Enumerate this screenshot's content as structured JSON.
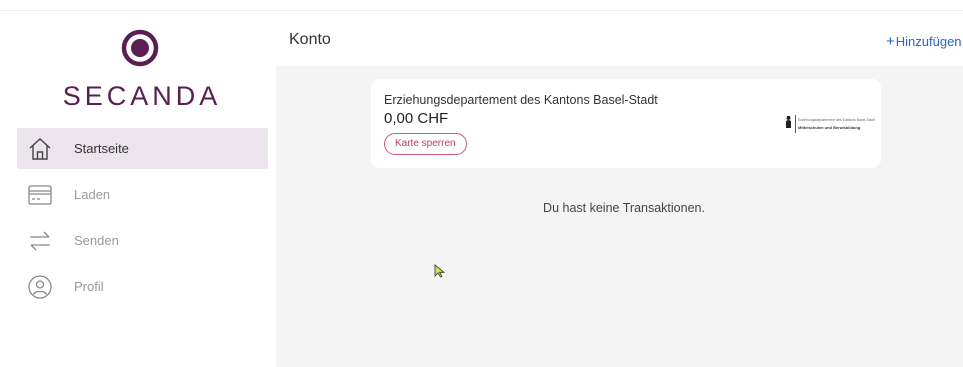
{
  "brand": {
    "name": "SECANDA",
    "color": "#5a1e55"
  },
  "sidebar": {
    "items": [
      {
        "label": "Startseite",
        "icon": "home-icon",
        "active": true
      },
      {
        "label": "Laden",
        "icon": "card-icon",
        "active": false
      },
      {
        "label": "Senden",
        "icon": "transfer-arrows-icon",
        "active": false
      },
      {
        "label": "Profil",
        "icon": "user-circle-icon",
        "active": false
      }
    ]
  },
  "header": {
    "title": "Konto",
    "add_label": "Hinzufügen",
    "add_icon": "plus-icon"
  },
  "card": {
    "issuer": "Erziehungsdepartement des Kantons Basel-Stadt",
    "balance": "0,00 CHF",
    "block_label": "Karte sperren",
    "logo_line1": "Erziehungsdepartement des Kantons Basel-Stadt",
    "logo_line2": "Mittelschulen und Berufsbildung"
  },
  "transactions": {
    "empty_message": "Du hast keine Transaktionen."
  },
  "colors": {
    "accent": "#2a63d6",
    "danger": "#c0405f",
    "active_bg": "#ece4ec",
    "content_bg": "#f4f4f4"
  }
}
